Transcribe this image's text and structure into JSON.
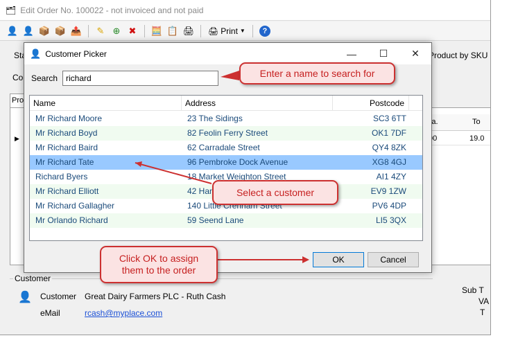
{
  "background_window": {
    "title": "Edit Order No. 100022 - not invoiced and not paid",
    "toolbar": {
      "icons": [
        "customer-icon",
        "customer-alt-icon",
        "items-icon",
        "items-alt-icon",
        "export-icon",
        "edit-icon",
        "add-icon",
        "delete-icon",
        "calculator-icon",
        "copy-icon",
        "printer-icon"
      ],
      "print_label": "Print",
      "help_icon": "help-icon"
    },
    "left_label_1": "Sta",
    "left_label_2": "Con",
    "tab_label": "Pro",
    "right_label": "Product by SKU",
    "grid_header_ea": "Ea.",
    "grid_header_to": "To",
    "grid_row_val1": ".00",
    "grid_row_val2": "19.0",
    "customer_group": {
      "legend": "Customer",
      "customer_label": "Customer",
      "customer_value": "Great Dairy Farmers PLC - Ruth Cash",
      "email_label": "eMail",
      "email_value": "rcash@myplace.com"
    },
    "side_labels": [
      "Sub T",
      "VA",
      "T"
    ]
  },
  "dialog": {
    "title": "Customer Picker",
    "search_label": "Search",
    "search_value": "richard",
    "columns": [
      "Name",
      "Address",
      "Postcode"
    ],
    "rows": [
      {
        "name": "Mr Richard Moore",
        "address": "23 The Sidings",
        "postcode": "SC3 6TT"
      },
      {
        "name": "Mr Richard Boyd",
        "address": "82 Feolin Ferry Street",
        "postcode": "OK1 7DF"
      },
      {
        "name": "Mr Richard Baird",
        "address": "62 Carradale Street",
        "postcode": "QY4 8ZK"
      },
      {
        "name": "Mr Richard Tate",
        "address": "96 Pembroke Dock Avenue",
        "postcode": "XG8 4GJ"
      },
      {
        "name": "Richard Byers",
        "address": "18 Market Weighton Street",
        "postcode": "AI1 4ZY"
      },
      {
        "name": "Mr Richard Elliott",
        "address": "42 Hann",
        "postcode": "EV9 1ZW"
      },
      {
        "name": "Mr Richard Gallagher",
        "address": "140 Little Crenham Street",
        "postcode": "PV6 4DP"
      },
      {
        "name": "Mr Orlando Richard",
        "address": "59 Seend Lane",
        "postcode": "LI5 3QX"
      }
    ],
    "selected_index": 3,
    "ok_label": "OK",
    "cancel_label": "Cancel"
  },
  "callouts": {
    "search": "Enter a name to search for",
    "select": "Select a customer",
    "ok_line1": "Click OK to assign",
    "ok_line2": "them to the order"
  },
  "colors": {
    "callout_border": "#cc3030",
    "callout_fill": "#fbe3e3",
    "selected_row": "#99c9ff",
    "alt_row": "#f0fbf0"
  }
}
